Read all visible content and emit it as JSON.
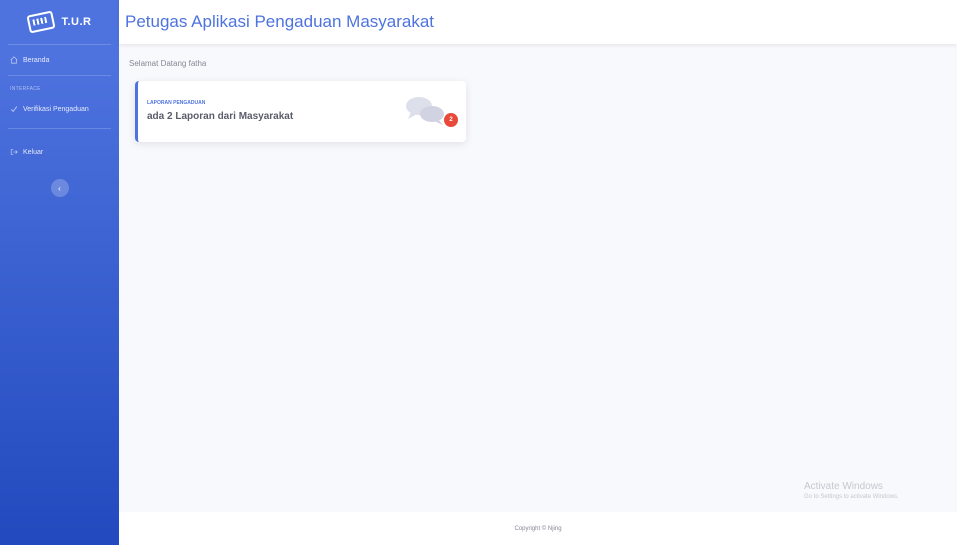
{
  "brand": {
    "name": "T.U.R",
    "icon": "keyboard-icon"
  },
  "sidebar": {
    "items": [
      {
        "label": "Beranda",
        "icon": "home-icon"
      }
    ],
    "section_heading": "INTERFACE",
    "interface_items": [
      {
        "label": "Verifikasi Pengaduan",
        "icon": "check-icon"
      }
    ],
    "logout": {
      "label": "Keluar",
      "icon": "sign-out-icon"
    },
    "toggle_icon": "chevron-left-icon"
  },
  "header": {
    "title": "Petugas Aplikasi Pengaduan Masyarakat"
  },
  "main": {
    "welcome": "Selamat Datang fatha",
    "card": {
      "label": "LAPORAN PENGADUAN",
      "value": "ada 2 Laporan dari Masyarakat",
      "icon": "comments-icon",
      "badge": "2"
    }
  },
  "watermark": {
    "title": "Activate Windows",
    "subtitle": "Go to Settings to activate Windows."
  },
  "footer": {
    "text": "Copyright © Njing"
  },
  "colors": {
    "primary": "#4e73df",
    "sidebar_end": "#224abe",
    "badge": "#e74a3b"
  }
}
